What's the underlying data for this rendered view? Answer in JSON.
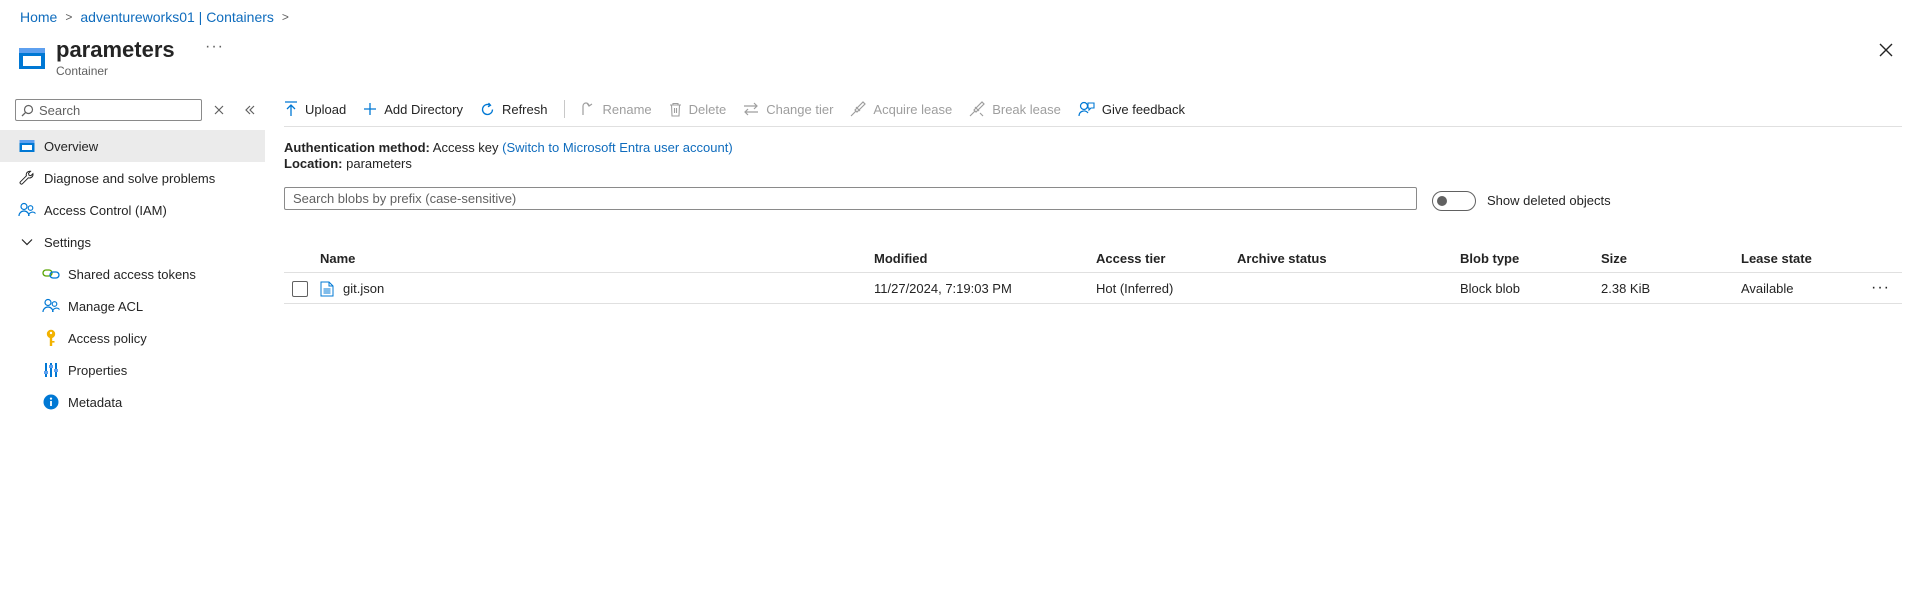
{
  "breadcrumb": {
    "items": [
      "Home",
      "adventureworks01 | Containers"
    ]
  },
  "header": {
    "title": "parameters",
    "subtitle": "Container",
    "more": "···"
  },
  "nav": {
    "search_placeholder": "Search",
    "items": [
      {
        "label": "Overview",
        "icon": "container-icon",
        "active": true
      },
      {
        "label": "Diagnose and solve problems",
        "icon": "wrench-icon"
      },
      {
        "label": "Access Control (IAM)",
        "icon": "people-icon"
      },
      {
        "label": "Settings",
        "icon": "chevron-down-icon"
      },
      {
        "label": "Shared access tokens",
        "icon": "link-icon"
      },
      {
        "label": "Manage ACL",
        "icon": "people-icon"
      },
      {
        "label": "Access policy",
        "icon": "key-icon"
      },
      {
        "label": "Properties",
        "icon": "sliders-icon"
      },
      {
        "label": "Metadata",
        "icon": "info-icon"
      }
    ]
  },
  "toolbar": {
    "upload": "Upload",
    "add_directory": "Add Directory",
    "refresh": "Refresh",
    "rename": "Rename",
    "delete": "Delete",
    "change_tier": "Change tier",
    "acquire_lease": "Acquire lease",
    "break_lease": "Break lease",
    "give_feedback": "Give feedback"
  },
  "info": {
    "auth_label": "Authentication method:",
    "auth_value": "Access key",
    "auth_link": "(Switch to Microsoft Entra user account)",
    "location_label": "Location:",
    "location_value": "parameters"
  },
  "blob_search": {
    "placeholder": "Search blobs by prefix (case-sensitive)"
  },
  "show_deleted": {
    "label": "Show deleted objects",
    "on": false
  },
  "table": {
    "columns": [
      "Name",
      "Modified",
      "Access tier",
      "Archive status",
      "Blob type",
      "Size",
      "Lease state"
    ],
    "rows": [
      {
        "name": "git.json",
        "modified": "11/27/2024, 7:19:03 PM",
        "access_tier": "Hot (Inferred)",
        "archive_status": "",
        "blob_type": "Block blob",
        "size": "2.38 KiB",
        "lease_state": "Available"
      }
    ]
  },
  "colors": {
    "link": "#0f6cbd",
    "accent": "#0078d4",
    "disabled": "#9e9e9e",
    "key": "#f2b200"
  }
}
